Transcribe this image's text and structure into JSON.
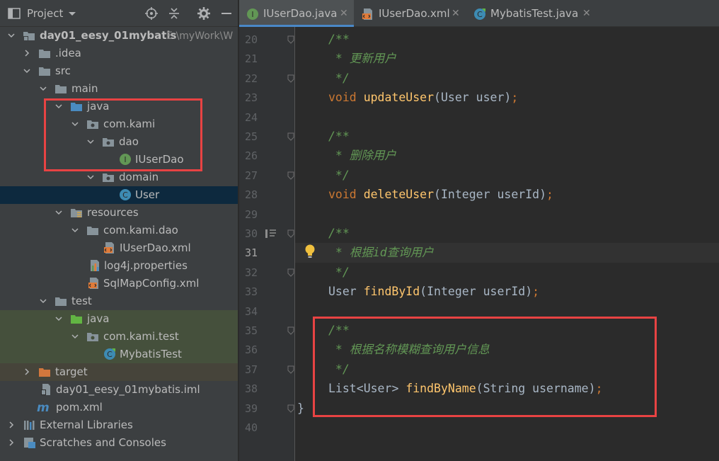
{
  "project_panel": {
    "title": "Project",
    "tree": [
      {
        "label": "day01_eesy_01mybatis",
        "path": "E:\\myWork\\W",
        "icon": "module-folder-icon",
        "bold": true
      },
      {
        "label": ".idea",
        "icon": "folder-icon"
      },
      {
        "label": "src",
        "icon": "folder-icon"
      },
      {
        "label": "main",
        "icon": "folder-icon"
      },
      {
        "label": "java",
        "icon": "source-folder-icon"
      },
      {
        "label": "com.kami",
        "icon": "package-icon"
      },
      {
        "label": "dao",
        "icon": "package-icon"
      },
      {
        "label": "IUserDao",
        "icon": "interface-icon"
      },
      {
        "label": "domain",
        "icon": "package-icon"
      },
      {
        "label": "User",
        "icon": "class-icon"
      },
      {
        "label": "resources",
        "icon": "resources-folder-icon"
      },
      {
        "label": "com.kami.dao",
        "icon": "folder-icon"
      },
      {
        "label": "IUserDao.xml",
        "icon": "xml-file-icon"
      },
      {
        "label": "log4j.properties",
        "icon": "properties-file-icon"
      },
      {
        "label": "SqlMapConfig.xml",
        "icon": "xml-file-icon"
      },
      {
        "label": "test",
        "icon": "folder-icon"
      },
      {
        "label": "java",
        "icon": "test-source-folder-icon"
      },
      {
        "label": "com.kami.test",
        "icon": "package-icon"
      },
      {
        "label": "MybatisTest",
        "icon": "test-class-icon"
      },
      {
        "label": "target",
        "icon": "excluded-folder-icon"
      },
      {
        "label": "day01_eesy_01mybatis.iml",
        "icon": "iml-file-icon"
      },
      {
        "label": "pom.xml",
        "icon": "maven-icon"
      },
      {
        "label": "External Libraries",
        "icon": "libraries-icon"
      },
      {
        "label": "Scratches and Consoles",
        "icon": "scratches-icon"
      }
    ]
  },
  "tabs": [
    {
      "label": "IUserDao.java",
      "icon": "interface-icon",
      "active": true
    },
    {
      "label": "IUserDao.xml",
      "icon": "xml-file-icon",
      "active": false
    },
    {
      "label": "MybatisTest.java",
      "icon": "test-class-icon",
      "active": false
    }
  ],
  "editor": {
    "current_line": 31,
    "lines": [
      {
        "n": "20",
        "code": "/**"
      },
      {
        "n": "21",
        "code": " * 更新用户"
      },
      {
        "n": "22",
        "code": " */"
      },
      {
        "n": "23",
        "code": "void updateUser(User user);"
      },
      {
        "n": "24",
        "code": ""
      },
      {
        "n": "25",
        "code": "/**"
      },
      {
        "n": "26",
        "code": " * 删除用户"
      },
      {
        "n": "27",
        "code": " */"
      },
      {
        "n": "28",
        "code": "void deleteUser(Integer userId);"
      },
      {
        "n": "29",
        "code": ""
      },
      {
        "n": "30",
        "code": "/**"
      },
      {
        "n": "31",
        "code": " * 根据id查询用户"
      },
      {
        "n": "32",
        "code": " */"
      },
      {
        "n": "33",
        "code": "User findById(Integer userId);"
      },
      {
        "n": "34",
        "code": ""
      },
      {
        "n": "35",
        "code": "/**"
      },
      {
        "n": "36",
        "code": " * 根据名称模糊查询用户信息"
      },
      {
        "n": "37",
        "code": " */"
      },
      {
        "n": "38",
        "code": "List<User> findByName(String username);"
      },
      {
        "n": "39",
        "code": "}"
      },
      {
        "n": "40",
        "code": ""
      }
    ]
  },
  "colors": {
    "highlight_box": "#e84343",
    "comment": "#629755",
    "keyword": "#cc7832",
    "method": "#ffc66d",
    "selection": "#0d293e"
  }
}
